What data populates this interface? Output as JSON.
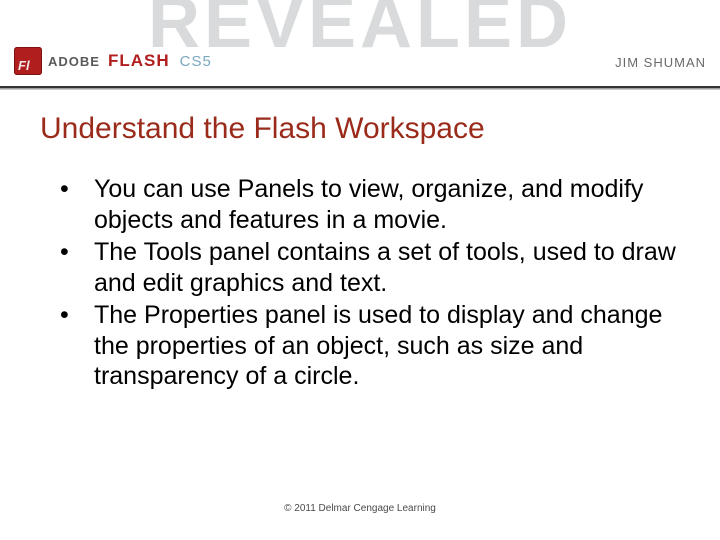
{
  "header": {
    "background_word": "REVEALED",
    "brand_adobe": "ADOBE",
    "brand_product": "FLASH",
    "brand_version": "CS5",
    "author": "JIM SHUMAN"
  },
  "slide": {
    "title": "Understand the Flash Workspace",
    "bullets": [
      "You can use Panels to view, organize, and modify objects and features in a movie.",
      "The Tools panel contains a set of tools, used to draw and edit graphics and text.",
      "The Properties panel is used to display and change the properties of an object, such as size and transparency of a circle."
    ]
  },
  "footer": {
    "copyright": "© 2011 Delmar Cengage Learning"
  }
}
